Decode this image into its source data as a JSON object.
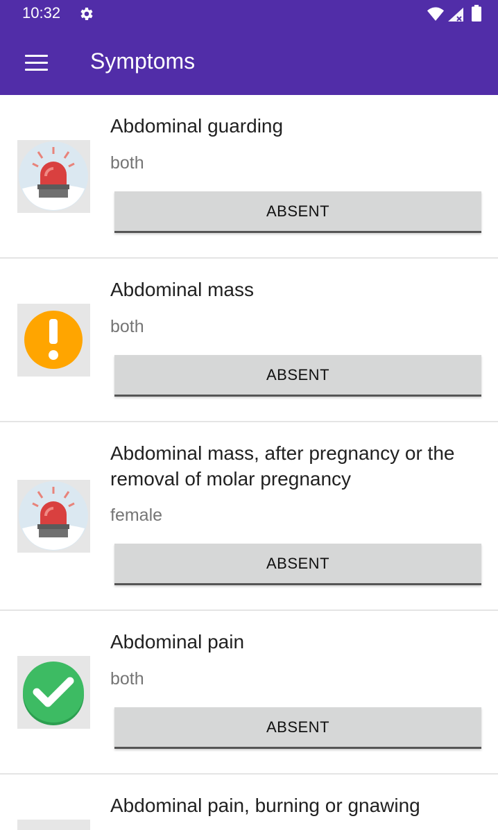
{
  "status_bar": {
    "time": "10:32",
    "icons": [
      "gear-icon",
      "wifi-icon",
      "signal-icon",
      "battery-icon"
    ]
  },
  "app_bar": {
    "title": "Symptoms",
    "menu_icon": "menu-icon",
    "color": "#512da8"
  },
  "symptoms": [
    {
      "title": "Abdominal guarding",
      "sex": "both",
      "icon": "siren-icon",
      "button": "ABSENT"
    },
    {
      "title": "Abdominal mass",
      "sex": "both",
      "icon": "warning-icon",
      "button": "ABSENT"
    },
    {
      "title": "Abdominal mass, after pregnancy or the removal of molar pregnancy",
      "sex": "female",
      "icon": "siren-icon",
      "button": "ABSENT"
    },
    {
      "title": "Abdominal pain",
      "sex": "both",
      "icon": "check-icon",
      "button": "ABSENT"
    },
    {
      "title": "Abdominal pain, burning or gnawing",
      "sex": "",
      "icon": "",
      "button": ""
    }
  ],
  "colors": {
    "warning": "#ffa500",
    "ok": "#3dbb63",
    "siren": "#d9403f"
  }
}
